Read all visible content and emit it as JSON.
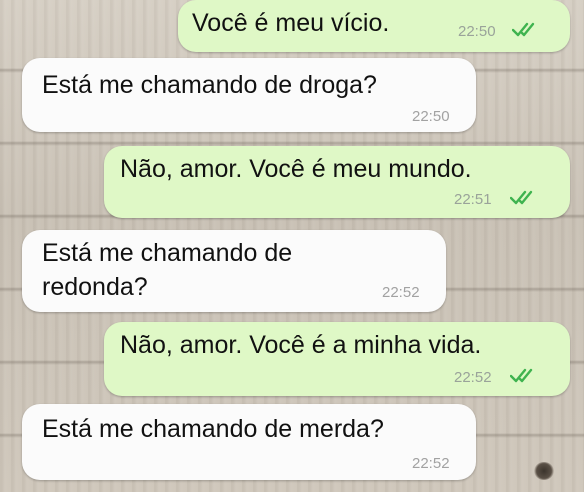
{
  "chat": {
    "messages": [
      {
        "direction": "out",
        "text": "Você é meu vício.",
        "time": "22:50",
        "read": true
      },
      {
        "direction": "in",
        "text": "Está me chamando de droga?",
        "time": "22:50"
      },
      {
        "direction": "out",
        "text": "Não, amor. Você é meu mundo.",
        "time": "22:51",
        "read": true
      },
      {
        "direction": "in",
        "text_line1": "Está me chamando de",
        "text_line2": "redonda?",
        "time": "22:52"
      },
      {
        "direction": "out",
        "text": "Não, amor. Você é a minha vida.",
        "time": "22:52",
        "read": true
      },
      {
        "direction": "in",
        "text": "Está me chamando de merda?",
        "time": "22:52"
      }
    ]
  },
  "colors": {
    "outgoing_bubble": "#dff8c6",
    "incoming_bubble": "#fbfbfb",
    "read_ticks": "#3fb34f"
  },
  "icons": {
    "read_receipt": "double-check-icon"
  }
}
